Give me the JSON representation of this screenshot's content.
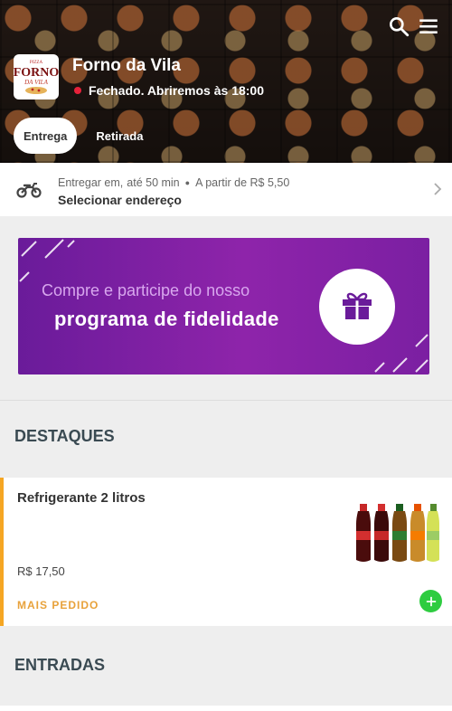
{
  "header": {
    "store_name": "Forno da Vila",
    "status_text": "Fechado. Abriremos às 18:00",
    "logo_text_top": "PIZZA",
    "logo_text_main": "FORNO",
    "logo_text_sub": "DA VILA",
    "tabs": [
      {
        "label": "Entrega",
        "active": true
      },
      {
        "label": "Retirada",
        "active": false
      }
    ]
  },
  "delivery": {
    "prefix": "Entregar em,",
    "time": "até 50 min",
    "min_price": "A partir de R$ 5,50",
    "address_cta": "Selecionar endereço"
  },
  "banner": {
    "line1": "Compre e participe do nosso",
    "line2": "programa de fidelidade"
  },
  "sections": [
    {
      "title": "DESTAQUES"
    },
    {
      "title": "ENTRADAS"
    }
  ],
  "products": [
    {
      "name": "Refrigerante 2 litros",
      "price": "R$ 17,50",
      "badge": "MAIS PEDIDO"
    }
  ],
  "colors": {
    "accent_purple": "#7b1fa2",
    "status_red": "#e7213a",
    "badge_orange": "#e8a23b",
    "add_green": "#2ecc40"
  },
  "icons": [
    "search-icon",
    "menu-icon",
    "motorcycle-icon",
    "chevron-right-icon",
    "gift-icon",
    "plus-icon"
  ]
}
